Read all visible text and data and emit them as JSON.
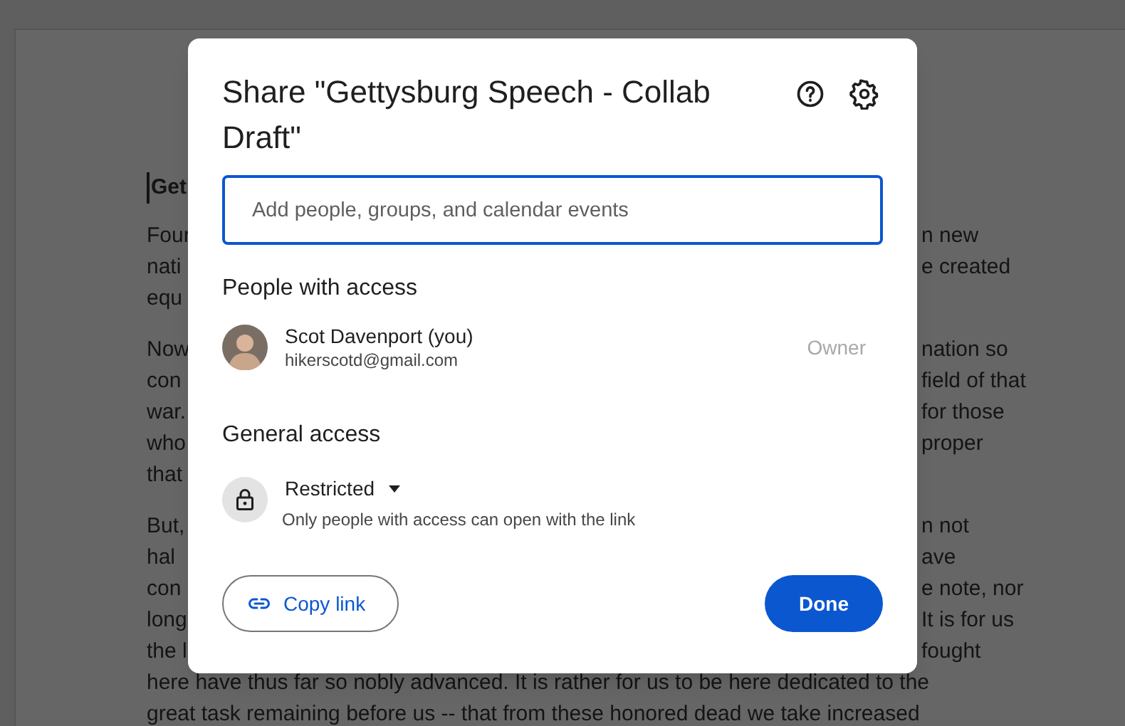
{
  "document": {
    "heading": "Get",
    "paragraphs": [
      [
        {
          "left": "Four",
          "right": "n new"
        },
        {
          "left": "nati",
          "right": "e created"
        },
        {
          "left": "equ"
        }
      ],
      [
        {
          "left": "Now",
          "right": "nation so"
        },
        {
          "left": "con",
          "right": "field of that"
        },
        {
          "left": "war.",
          "right": "for those"
        },
        {
          "left": "who",
          "right": "proper"
        },
        {
          "left": "that"
        }
      ],
      [
        {
          "left": "But,",
          "right": "n not"
        },
        {
          "left": "hal",
          "right": "ave"
        },
        {
          "left": "con",
          "right": "e note, nor"
        },
        {
          "left": "long",
          "right": "It is for us"
        },
        {
          "left": "the l",
          "right": "fought"
        },
        {
          "left": "here have thus far so nobly advanced. It is rather for us to be here dedicated to the"
        },
        {
          "left": "great task remaining before us -- that from these honored dead we take increased"
        }
      ]
    ]
  },
  "dialog": {
    "title": "Share \"Gettysburg Speech - Collab Draft\"",
    "search": {
      "placeholder": "Add people, groups, and calendar events"
    },
    "people_section": "People with access",
    "people": [
      {
        "name": "Scot Davenport (you)",
        "email": "hikerscotd@gmail.com",
        "role": "Owner"
      }
    ],
    "general_section": "General access",
    "access": {
      "level": "Restricted",
      "description": "Only people with access can open with the link"
    },
    "buttons": [
      {
        "label": "Copy link",
        "kind": "outlined"
      },
      {
        "label": "Done",
        "kind": "filled"
      }
    ]
  }
}
